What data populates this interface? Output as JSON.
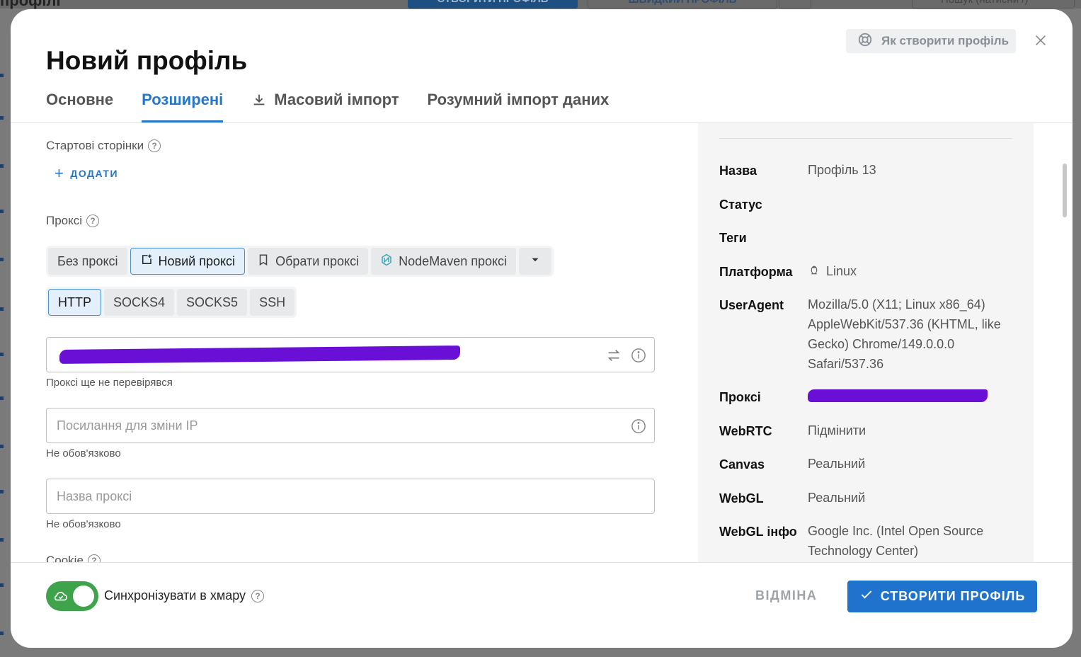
{
  "background": {
    "title": "профілі",
    "create_button": "СТВОРИТИ ПРОФІЛЬ",
    "quick_button": "ШВИДКИЙ ПРОФІЛЬ",
    "search_placeholder": "Пошук (натисни /)"
  },
  "modal": {
    "title": "Новий профіль",
    "help_button": "Як створити профіль",
    "tabs": [
      {
        "label": "Основне",
        "active": false
      },
      {
        "label": "Розширені",
        "active": true
      },
      {
        "label": "Масовий імпорт",
        "active": false,
        "icon": "download-icon"
      },
      {
        "label": "Розумний імпорт даних",
        "active": false
      }
    ]
  },
  "start_pages": {
    "label": "Стартові сторінки",
    "add_label": "ДОДАТИ"
  },
  "proxy": {
    "label": "Проксі",
    "modes": [
      {
        "label": "Без проксі",
        "selected": false
      },
      {
        "label": "Новий проксі",
        "selected": true,
        "icon": "new-proxy-icon"
      },
      {
        "label": "Обрати проксі",
        "selected": false,
        "icon": "bookmark-icon"
      },
      {
        "label": "NodeMaven проксі",
        "selected": false,
        "icon": "nodemaven-icon"
      }
    ],
    "types": [
      {
        "label": "HTTP",
        "selected": true
      },
      {
        "label": "SOCKS4",
        "selected": false
      },
      {
        "label": "SOCKS5",
        "selected": false
      },
      {
        "label": "SSH",
        "selected": false
      }
    ],
    "address_value": "",
    "address_status": "Проксі ще не перевірявся",
    "change_ip_placeholder": "Посилання для зміни IP",
    "change_ip_helper": "Не обов'язково",
    "name_placeholder": "Назва проксі",
    "name_helper": "Не обов'язково"
  },
  "cookie": {
    "label": "Cookie"
  },
  "summary": [
    {
      "label": "Назва",
      "value": "Профіль 13"
    },
    {
      "label": "Статус",
      "value": ""
    },
    {
      "label": "Теги",
      "value": ""
    },
    {
      "label": "Платформа",
      "value": "Linux",
      "icon": "linux-icon"
    },
    {
      "label": "UserAgent",
      "value": "Mozilla/5.0 (X11; Linux x86_64) AppleWebKit/537.36 (KHTML, like Gecko) Chrome/149.0.0.0 Safari/537.36"
    },
    {
      "label": "Проксі",
      "value": ""
    },
    {
      "label": "WebRTC",
      "value": "Підмінити"
    },
    {
      "label": "Canvas",
      "value": "Реальний"
    },
    {
      "label": "WebGL",
      "value": "Реальний"
    },
    {
      "label": "WebGL інфо",
      "value": "Google Inc. (Intel Open Source Technology Center)"
    }
  ],
  "footer": {
    "sync_label": "Синхронізувати в хмару",
    "sync_enabled": true,
    "cancel_label": "ВІДМІНА",
    "create_label": "СТВОРИТИ ПРОФІЛЬ"
  },
  "colors": {
    "accent": "#2677c9",
    "toggle_on": "#3ea34a",
    "redaction": "#6a0fd6"
  }
}
